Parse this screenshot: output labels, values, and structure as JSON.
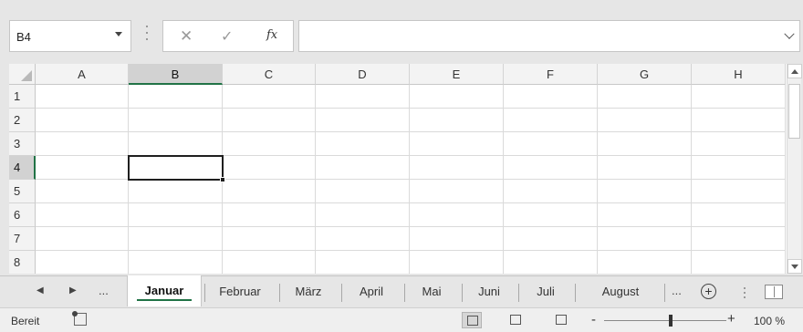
{
  "formula_bar": {
    "name_box": "B4",
    "cancel_glyph": "✕",
    "enter_glyph": "✓",
    "fx_label": "fx",
    "formula_value": ""
  },
  "grid": {
    "columns": [
      "A",
      "B",
      "C",
      "D",
      "E",
      "F",
      "G",
      "H"
    ],
    "rows": [
      "1",
      "2",
      "3",
      "4",
      "5",
      "6",
      "7",
      "8"
    ],
    "selected_column": "B",
    "selected_row": "4",
    "active_cell": "B4"
  },
  "sheet_tabs": {
    "nav_prev": "◀",
    "nav_next": "▶",
    "overflow_left": "...",
    "tabs": [
      "Januar",
      "Februar",
      "März",
      "April",
      "Mai",
      "Juni",
      "Juli",
      "August"
    ],
    "active_tab": "Januar",
    "overflow_right": "...",
    "add_sheet": "+"
  },
  "status_bar": {
    "status": "Bereit",
    "zoom": "100 %",
    "zoom_minus": "-",
    "zoom_plus": "+"
  },
  "colors": {
    "accent": "#217346",
    "header_bg": "#f3f3f3",
    "header_selected_bg": "#d2d2d2",
    "chrome_bg": "#e6e6e6"
  },
  "icons": {
    "name_box_dropdown": "chevron-down-icon",
    "cancel": "close-icon",
    "enter": "check-icon",
    "insert_function": "fx-icon",
    "expand_formula": "chevron-down-icon",
    "new_sheet": "plus-circle-icon",
    "macro": "macro-record-icon",
    "normal_view": "grid-view-icon",
    "page_layout_view": "page-layout-icon",
    "page_break_view": "page-break-icon"
  }
}
